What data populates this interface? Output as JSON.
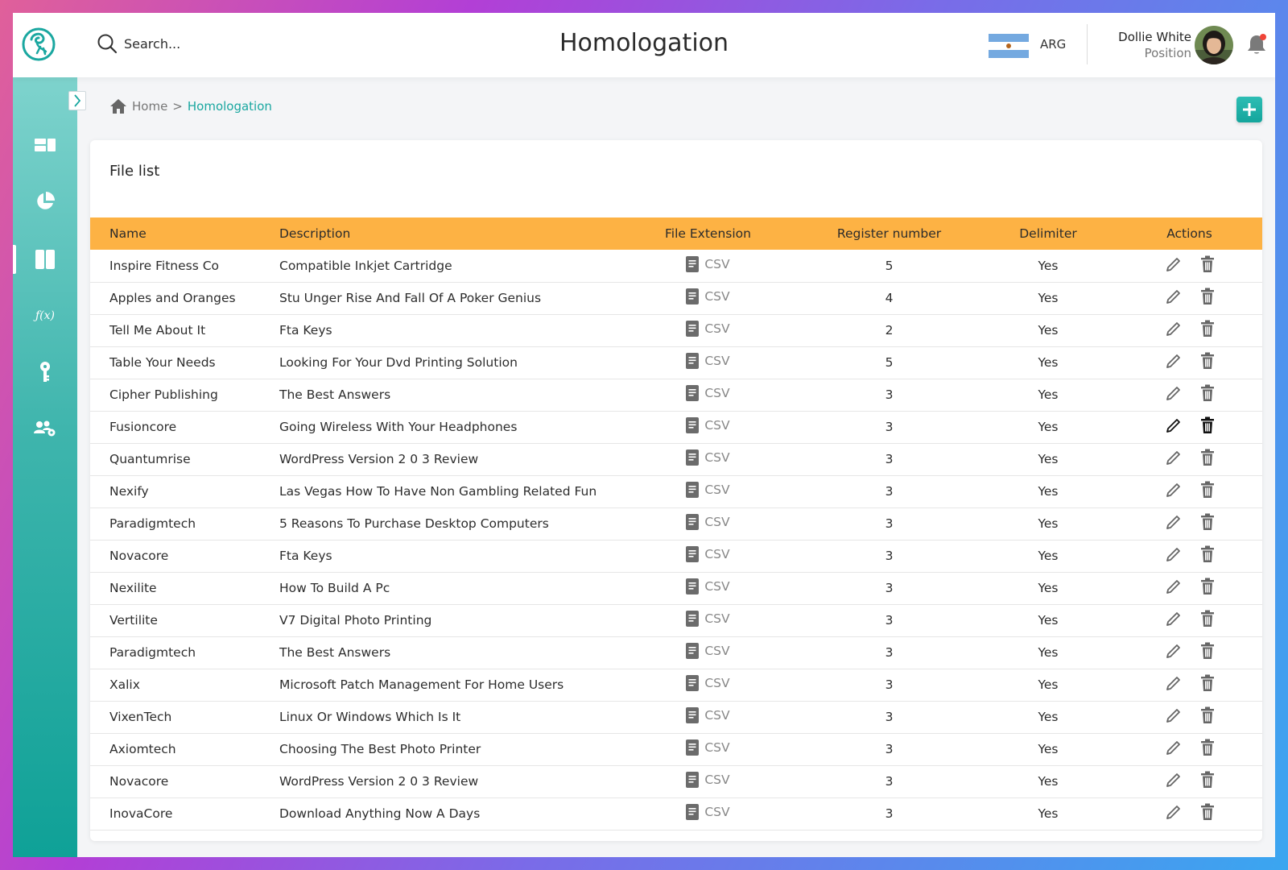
{
  "header": {
    "title": "Homologation",
    "search_placeholder": "Search...",
    "country": "ARG",
    "user": {
      "name": "Dollie White",
      "position": "Position"
    }
  },
  "sidebar": {
    "items": [
      {
        "name": "dashboard",
        "icon": "dashboard-icon"
      },
      {
        "name": "reports",
        "icon": "pie-chart-icon"
      },
      {
        "name": "homologation",
        "icon": "book-icon",
        "active": true
      },
      {
        "name": "functions",
        "icon": "function-icon",
        "label": "ƒ(x)"
      },
      {
        "name": "keys",
        "icon": "key-icon"
      },
      {
        "name": "users",
        "icon": "users-settings-icon"
      }
    ]
  },
  "breadcrumb": {
    "home": "Home",
    "separator": ">",
    "current": "Homologation"
  },
  "card": {
    "title": "File list",
    "columns": [
      "Name",
      "Description",
      "File Extension",
      "Register number",
      "Delimiter",
      "Actions"
    ],
    "rows": [
      {
        "name": "Inspire Fitness Co",
        "description": "Compatible Inkjet Cartridge",
        "ext": "CSV",
        "register": "5",
        "delimiter": "Yes"
      },
      {
        "name": "Apples and Oranges",
        "description": "Stu Unger Rise And Fall Of A Poker Genius",
        "ext": "CSV",
        "register": "4",
        "delimiter": "Yes"
      },
      {
        "name": "Tell Me About It",
        "description": "Fta Keys",
        "ext": "CSV",
        "register": "2",
        "delimiter": "Yes"
      },
      {
        "name": "Table Your Needs",
        "description": "Looking For Your Dvd Printing Solution",
        "ext": "CSV",
        "register": "5",
        "delimiter": "Yes"
      },
      {
        "name": "Cipher Publishing",
        "description": "The Best Answers",
        "ext": "CSV",
        "register": "3",
        "delimiter": "Yes"
      },
      {
        "name": "Fusioncore",
        "description": "Going Wireless With Your Headphones",
        "ext": "CSV",
        "register": "3",
        "delimiter": "Yes",
        "hover": true
      },
      {
        "name": "Quantumrise",
        "description": "WordPress Version 2 0 3 Review",
        "ext": "CSV",
        "register": "3",
        "delimiter": "Yes"
      },
      {
        "name": "Nexify",
        "description": "Las Vegas How To Have Non Gambling Related Fun",
        "ext": "CSV",
        "register": "3",
        "delimiter": "Yes"
      },
      {
        "name": "Paradigmtech",
        "description": "5 Reasons To Purchase Desktop Computers",
        "ext": "CSV",
        "register": "3",
        "delimiter": "Yes"
      },
      {
        "name": "Novacore",
        "description": "Fta Keys",
        "ext": "CSV",
        "register": "3",
        "delimiter": "Yes"
      },
      {
        "name": "Nexilite",
        "description": "How To Build A Pc",
        "ext": "CSV",
        "register": "3",
        "delimiter": "Yes"
      },
      {
        "name": "Vertilite",
        "description": "V7 Digital Photo Printing",
        "ext": "CSV",
        "register": "3",
        "delimiter": "Yes"
      },
      {
        "name": "Paradigmtech",
        "description": "The Best Answers",
        "ext": "CSV",
        "register": "3",
        "delimiter": "Yes"
      },
      {
        "name": "Xalix",
        "description": "Microsoft Patch Management For Home Users",
        "ext": "CSV",
        "register": "3",
        "delimiter": "Yes"
      },
      {
        "name": "VixenTech",
        "description": "Linux Or Windows Which Is It",
        "ext": "CSV",
        "register": "3",
        "delimiter": "Yes"
      },
      {
        "name": "Axiomtech",
        "description": "Choosing The Best Photo Printer",
        "ext": "CSV",
        "register": "3",
        "delimiter": "Yes"
      },
      {
        "name": "Novacore",
        "description": "WordPress Version 2 0 3 Review",
        "ext": "CSV",
        "register": "3",
        "delimiter": "Yes"
      },
      {
        "name": "InovaCore",
        "description": "Download Anything Now A Days",
        "ext": "CSV",
        "register": "3",
        "delimiter": "Yes"
      }
    ]
  },
  "colors": {
    "accent": "#1aa7a0",
    "table_header": "#fdb244",
    "sidebar_top": "#7ed3cd",
    "sidebar_bottom": "#0fa197",
    "notification_dot": "#f04438"
  }
}
